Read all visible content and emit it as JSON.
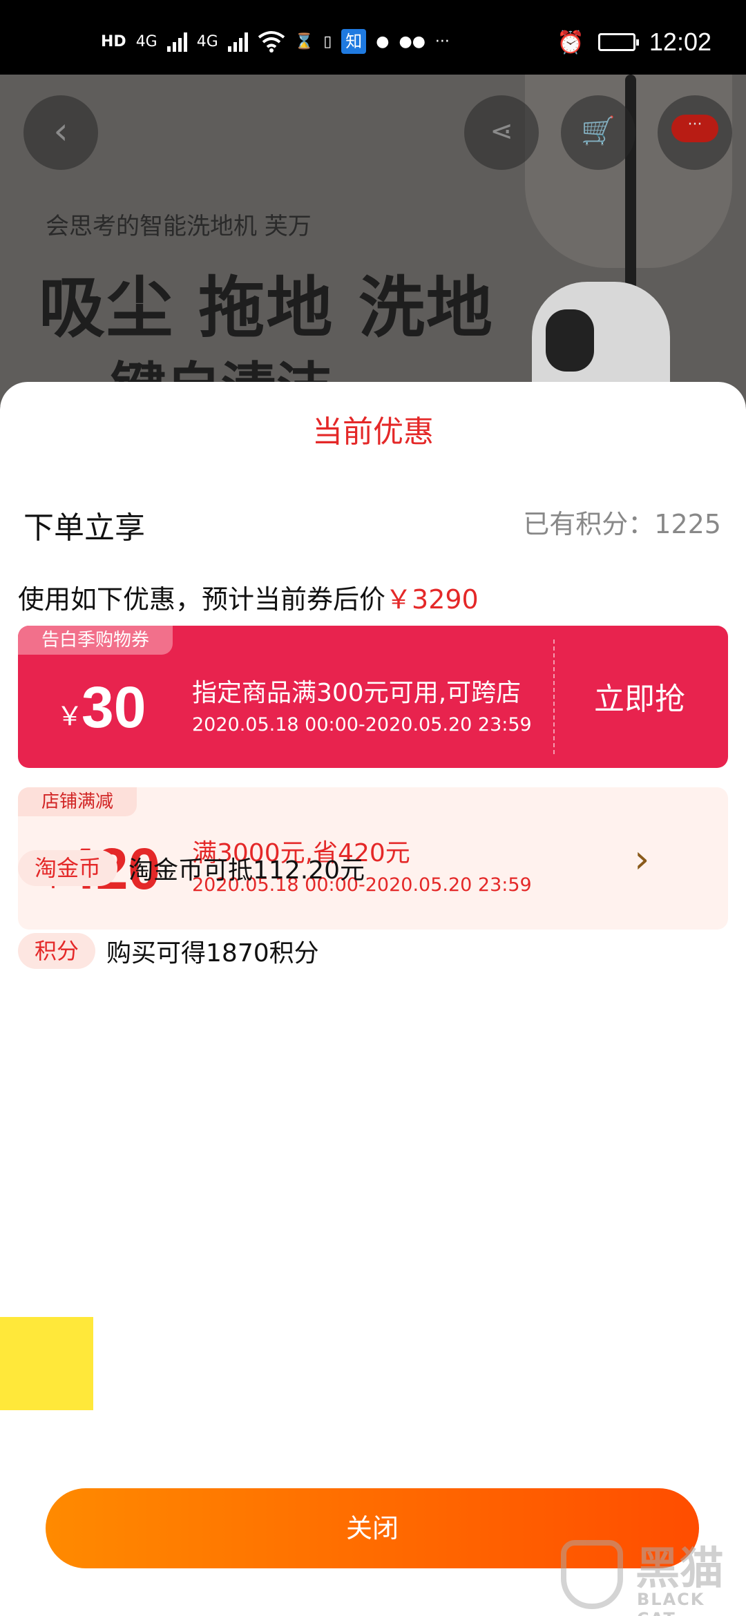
{
  "status_bar": {
    "hd": "HD",
    "sim1": "4G",
    "sim2": "4G",
    "zhihu": "知",
    "time": "12:02",
    "icons": [
      "hd-icon",
      "signal-icon",
      "signal-icon",
      "wifi-icon",
      "hourglass-icon",
      "notification-icon",
      "zhihu-icon",
      "message-icon",
      "wechat-icon",
      "more-icon",
      "alarm-icon",
      "battery-icon"
    ]
  },
  "product_bg": {
    "subtitle": "会思考的智能洗地机 芙万",
    "headline": "吸尘 拖地 洗地",
    "headline2": "键自清洁",
    "more_badge": "···"
  },
  "sheet": {
    "title": "当前优惠",
    "order_label": "下单立享",
    "points_balance": "已有积分：1225",
    "hint_prefix": "使用如下优惠，预计当前券后价",
    "hint_price": "￥3290"
  },
  "coupons": [
    {
      "tag": "告白季购物券",
      "currency": "￥",
      "amount": "30",
      "desc": "指定商品满300元可用,可跨店",
      "date": "2020.05.18 00:00-2020.05.20 23:59",
      "action": "立即抢"
    },
    {
      "tag": "店铺满减",
      "currency": "￥",
      "amount": "420",
      "desc": "满3000元,省420元",
      "date": "2020.05.18 00:00-2020.05.20 23:59"
    }
  ],
  "extras": [
    {
      "pill": "淘金币",
      "text": "淘金币可抵112.20元"
    },
    {
      "pill": "积分",
      "text": "购买可得1870积分"
    }
  ],
  "close_label": "关闭",
  "watermark": {
    "cn": "黑猫",
    "en": "BLACK CAT"
  },
  "colors": {
    "accent_red": "#e42828",
    "coupon_red": "#e8234e",
    "button_orange": "#ff6a00",
    "highlight_yellow": "#ffe83a"
  }
}
